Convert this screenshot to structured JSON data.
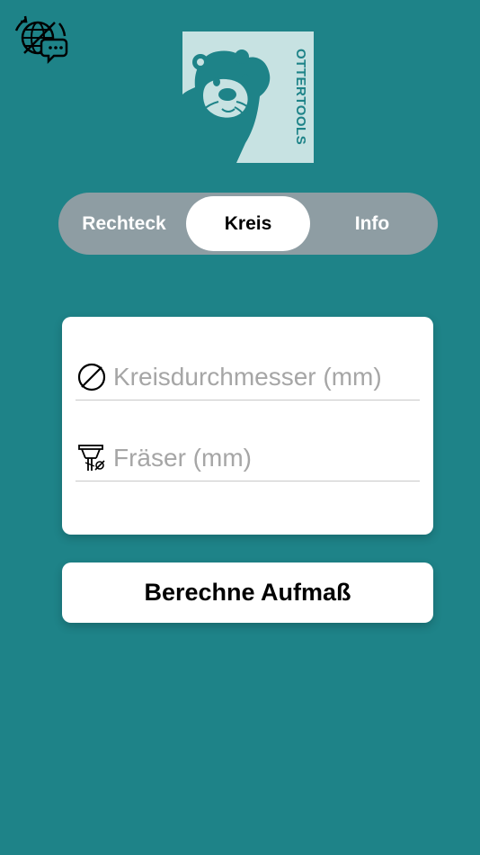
{
  "colors": {
    "background": "#1e8388",
    "logo_bg": "#c7e2e2",
    "segment_bg": "#8e9da3",
    "card_bg": "#ffffff"
  },
  "header": {
    "language_icon": "globe-translate-icon",
    "logo_text": "OTTERTOOLS"
  },
  "tabs": [
    {
      "label": "Rechteck",
      "active": false
    },
    {
      "label": "Kreis",
      "active": true
    },
    {
      "label": "Info",
      "active": false
    }
  ],
  "form": {
    "diameter": {
      "icon": "diameter-icon",
      "value": "",
      "placeholder": "Kreisdurchmesser (mm)"
    },
    "cutter": {
      "icon": "milling-cutter-icon",
      "value": "",
      "placeholder": "Fräser (mm)"
    }
  },
  "calculate_button": {
    "label": "Berechne Aufmaß"
  }
}
